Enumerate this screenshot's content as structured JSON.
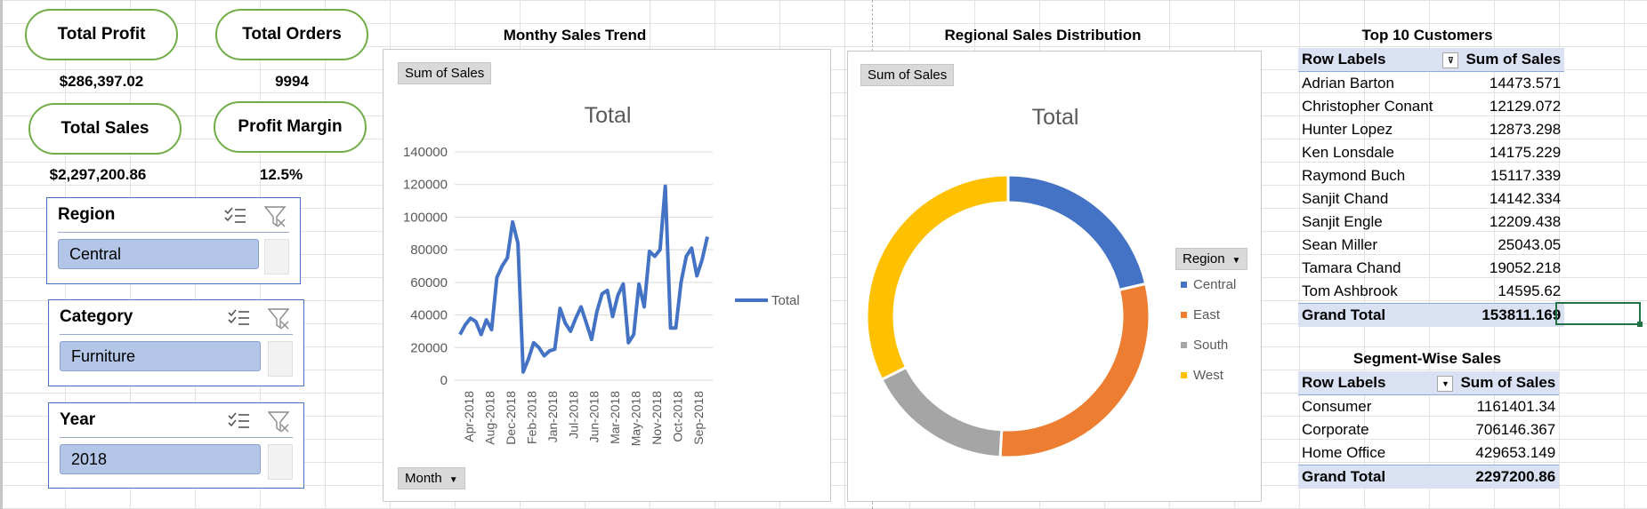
{
  "kpis": {
    "total_profit": {
      "label": "Total Profit",
      "value": "$286,397.02"
    },
    "total_orders": {
      "label": "Total Orders",
      "value": "9994"
    },
    "total_sales": {
      "label": "Total Sales",
      "value": "$2,297,200.86"
    },
    "profit_margin": {
      "label": "Profit Margin",
      "value": "12.5%"
    }
  },
  "slicers": {
    "region": {
      "title": "Region",
      "selected": "Central"
    },
    "category": {
      "title": "Category",
      "selected": "Furniture"
    },
    "year": {
      "title": "Year",
      "selected": "2018"
    }
  },
  "icons": {
    "multi_select": "multi-select-icon",
    "clear_filter": "clear-filter-icon",
    "dropdown": "chevron-down-icon"
  },
  "charts": {
    "line": {
      "title": "Monthy Sales Trend",
      "field_button": "Sum of Sales",
      "inner_title": "Total",
      "axis_button": "Month",
      "legend": "Total"
    },
    "donut": {
      "title": "Regional Sales Distribution",
      "field_button": "Sum of Sales",
      "inner_title": "Total",
      "legend_button": "Region"
    }
  },
  "chart_data": [
    {
      "type": "line",
      "title": "Total",
      "x_tick_labels": [
        "Apr-2018",
        "Aug-2018",
        "Dec-2018",
        "Feb-2018",
        "Jan-2018",
        "Jul-2018",
        "Jun-2018",
        "Mar-2018",
        "May-2018",
        "Nov-2018",
        "Oct-2018",
        "Sep-2018"
      ],
      "ylim": [
        0,
        140000
      ],
      "y_ticks": [
        0,
        20000,
        40000,
        60000,
        80000,
        100000,
        120000,
        140000
      ],
      "grid": true,
      "legend_position": "right",
      "color": "#4472c4",
      "series": [
        {
          "name": "Total",
          "values": [
            28000,
            34000,
            38000,
            36000,
            28000,
            37000,
            31000,
            63000,
            70000,
            75000,
            97000,
            84000,
            5000,
            13000,
            23000,
            20000,
            15000,
            18000,
            19000,
            44000,
            35000,
            30000,
            38000,
            45000,
            35000,
            25000,
            42000,
            53000,
            55000,
            39000,
            52000,
            59000,
            23000,
            28000,
            59000,
            45000,
            79000,
            76000,
            80000,
            119000,
            32000,
            32000,
            60000,
            76000,
            81000,
            64000,
            74000,
            88000
          ]
        }
      ]
    },
    {
      "type": "pie",
      "donut": true,
      "title": "Total",
      "legend_position": "right",
      "categories": [
        "Central",
        "East",
        "South",
        "West"
      ],
      "values": [
        21.3,
        29.6,
        16.7,
        32.4
      ],
      "colors": [
        "#4472c4",
        "#ed7d31",
        "#a5a5a5",
        "#ffc000"
      ]
    }
  ],
  "top_customers": {
    "title": "Top 10 Customers",
    "headers": [
      "Row Labels",
      "Sum of Sales"
    ],
    "rows": [
      [
        "Adrian Barton",
        "14473.571"
      ],
      [
        "Christopher Conant",
        "12129.072"
      ],
      [
        "Hunter Lopez",
        "12873.298"
      ],
      [
        "Ken Lonsdale",
        "14175.229"
      ],
      [
        "Raymond Buch",
        "15117.339"
      ],
      [
        "Sanjit Chand",
        "14142.334"
      ],
      [
        "Sanjit Engle",
        "12209.438"
      ],
      [
        "Sean Miller",
        "25043.05"
      ],
      [
        "Tamara Chand",
        "19052.218"
      ],
      [
        "Tom Ashbrook",
        "14595.62"
      ]
    ],
    "total": [
      "Grand Total",
      "153811.169"
    ]
  },
  "segment_sales": {
    "title": "Segment-Wise Sales",
    "headers": [
      "Row Labels",
      "Sum of Sales"
    ],
    "rows": [
      [
        "Consumer",
        "1161401.34"
      ],
      [
        "Corporate",
        "706146.367"
      ],
      [
        "Home Office",
        "429653.149"
      ]
    ],
    "total": [
      "Grand Total",
      "2297200.86"
    ]
  }
}
